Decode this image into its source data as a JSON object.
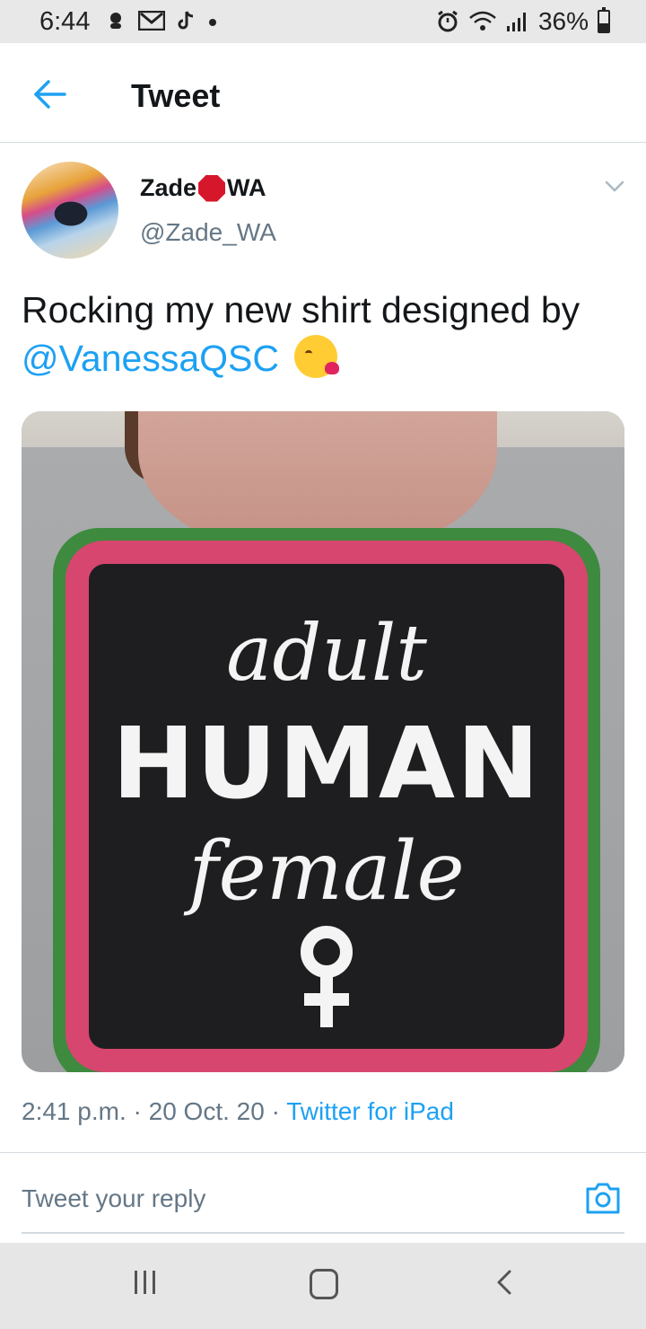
{
  "status_bar": {
    "time": "6:44",
    "battery": "36%",
    "left_icons": [
      "weather-icon",
      "gmail-icon",
      "tiktok-icon",
      "dot-icon"
    ],
    "right_icons": [
      "alarm-icon",
      "wifi-icon",
      "signal-icon",
      "battery-icon"
    ]
  },
  "header": {
    "title": "Tweet"
  },
  "author": {
    "name_first": "Zade",
    "name_second": "WA",
    "handle": "@Zade_WA"
  },
  "tweet": {
    "text": "Rocking my new shirt designed by",
    "mention": "@VanessaQSC",
    "emoji": "face-blowing-a-kiss"
  },
  "photo": {
    "line1": "adult",
    "line2": "HUMAN",
    "line3": "female"
  },
  "meta": {
    "time": "2:41 p.m.",
    "separator": "·",
    "date": "20 Oct. 20",
    "source": "Twitter for iPad"
  },
  "reply": {
    "placeholder": "Tweet your reply"
  },
  "colors": {
    "accent": "#1da1f2",
    "secondary_text": "#657786",
    "primary_text": "#14171a",
    "status_bar_bg": "#e8e8e8",
    "nav_bar_bg": "#e6e6e6"
  }
}
